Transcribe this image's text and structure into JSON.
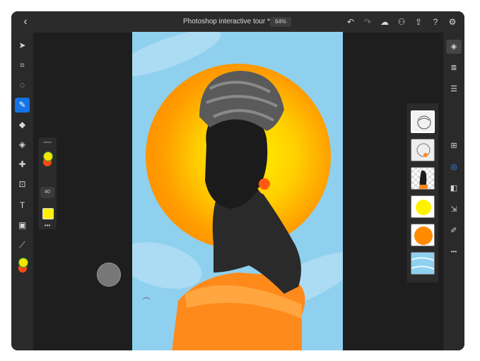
{
  "app": {
    "title": "Photoshop interactive tour *",
    "zoom": "64%"
  },
  "topbar": {
    "back_icon": "chevron-left-icon",
    "right_icons": [
      "undo-icon",
      "redo-icon",
      "cloud-icon",
      "user-share-icon",
      "export-icon",
      "help-icon",
      "settings-icon"
    ]
  },
  "tools": [
    {
      "name": "select-tool",
      "glyph": "➤"
    },
    {
      "name": "crop-transform-tool",
      "glyph": "⌗"
    },
    {
      "name": "lasso-tool",
      "glyph": "◌"
    },
    {
      "name": "brush-tool",
      "glyph": "✎",
      "active": true
    },
    {
      "name": "eraser-tool",
      "glyph": "◆"
    },
    {
      "name": "paint-bucket-tool",
      "glyph": "◈"
    },
    {
      "name": "healing-tool",
      "glyph": "✚"
    },
    {
      "name": "crop-tool",
      "glyph": "⊡"
    },
    {
      "name": "type-tool",
      "glyph": "T"
    },
    {
      "name": "place-image-tool",
      "glyph": "▣"
    },
    {
      "name": "eyedropper-tool",
      "glyph": "⟋"
    }
  ],
  "colors": {
    "foreground": "#f5e300",
    "background": "#ff4a10",
    "accent": "#1473e6"
  },
  "brush_panel": {
    "size": "40",
    "color": "#fff200",
    "more": "•••"
  },
  "layers": [
    {
      "name": "linework-layer",
      "selected": true
    },
    {
      "name": "sketch-color-layer"
    },
    {
      "name": "figure-layer"
    },
    {
      "name": "yellow-circle-layer"
    },
    {
      "name": "orange-circle-layer"
    },
    {
      "name": "sky-background-layer"
    }
  ],
  "right_rail": [
    {
      "name": "layers-icon",
      "glyph": "◈",
      "active": true
    },
    {
      "name": "layer-properties-icon",
      "glyph": "≣"
    },
    {
      "name": "adjustments-icon",
      "glyph": "☰"
    },
    {
      "name": "add-layer-icon",
      "glyph": "⊞"
    },
    {
      "name": "visibility-icon",
      "glyph": "◎",
      "blue": true
    },
    {
      "name": "mask-icon",
      "glyph": "◧"
    },
    {
      "name": "merge-icon",
      "glyph": "⇲"
    },
    {
      "name": "clear-icon",
      "glyph": "✐"
    },
    {
      "name": "more-icon",
      "glyph": "•••"
    }
  ]
}
